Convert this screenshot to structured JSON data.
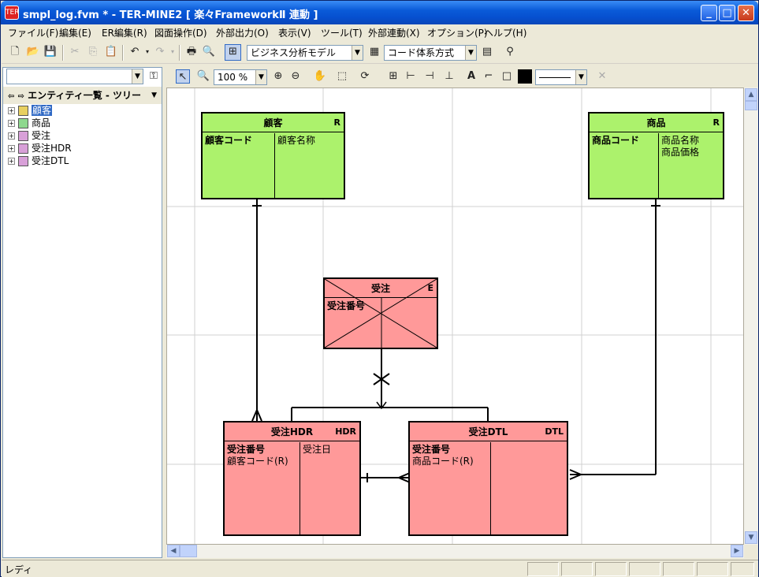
{
  "window": {
    "title": "smpl_log.fvm * - TER-MINE2 [ 楽々FrameworkⅡ 連動 ]",
    "app_icon": "TER"
  },
  "menu": [
    "ファイル(F)",
    "編集(E)",
    "ER編集(R)",
    "図面操作(D)",
    "外部出力(O)",
    "表示(V)",
    "ツール(T)",
    "外部連動(X)",
    "オプション(P)",
    "ヘルプ(H)"
  ],
  "toolbar": {
    "model_select": "ビジネス分析モデル",
    "code_select": "コード体系方式"
  },
  "drawbar": {
    "zoom": "100 %"
  },
  "leftpanel": {
    "search_value": "",
    "title": "エンティティ一覧 - ツリー",
    "tree": [
      {
        "label": "顧客",
        "selected": true,
        "color": "#c8a800"
      },
      {
        "label": "商品",
        "selected": false,
        "color": "#3aa23a"
      },
      {
        "label": "受注",
        "selected": false,
        "color": "#b05ab0"
      },
      {
        "label": "受注HDR",
        "selected": false,
        "color": "#b05ab0"
      },
      {
        "label": "受注DTL",
        "selected": false,
        "color": "#b05ab0"
      }
    ]
  },
  "entities": {
    "customer": {
      "name": "顧客",
      "tag": "R",
      "keys": [
        "顧客コード"
      ],
      "attrs": [
        "顧客名称"
      ]
    },
    "product": {
      "name": "商品",
      "tag": "R",
      "keys": [
        "商品コード"
      ],
      "attrs": [
        "商品名称",
        "商品価格"
      ]
    },
    "order": {
      "name": "受注",
      "tag": "E",
      "keys": [
        "受注番号"
      ],
      "attrs": []
    },
    "order_hdr": {
      "name": "受注HDR",
      "tag": "HDR",
      "keys": [
        "受注番号"
      ],
      "fk": [
        "顧客コード(R)"
      ],
      "attrs": [
        "受注日"
      ]
    },
    "order_dtl": {
      "name": "受注DTL",
      "tag": "DTL",
      "keys": [
        "受注番号"
      ],
      "fk": [
        "商品コード(R)"
      ],
      "attrs": []
    }
  },
  "status": {
    "text": "レディ"
  },
  "colors": {
    "resource_entity": "#acf26c",
    "event_entity": "#ff9999",
    "selection": "#316ac5"
  }
}
